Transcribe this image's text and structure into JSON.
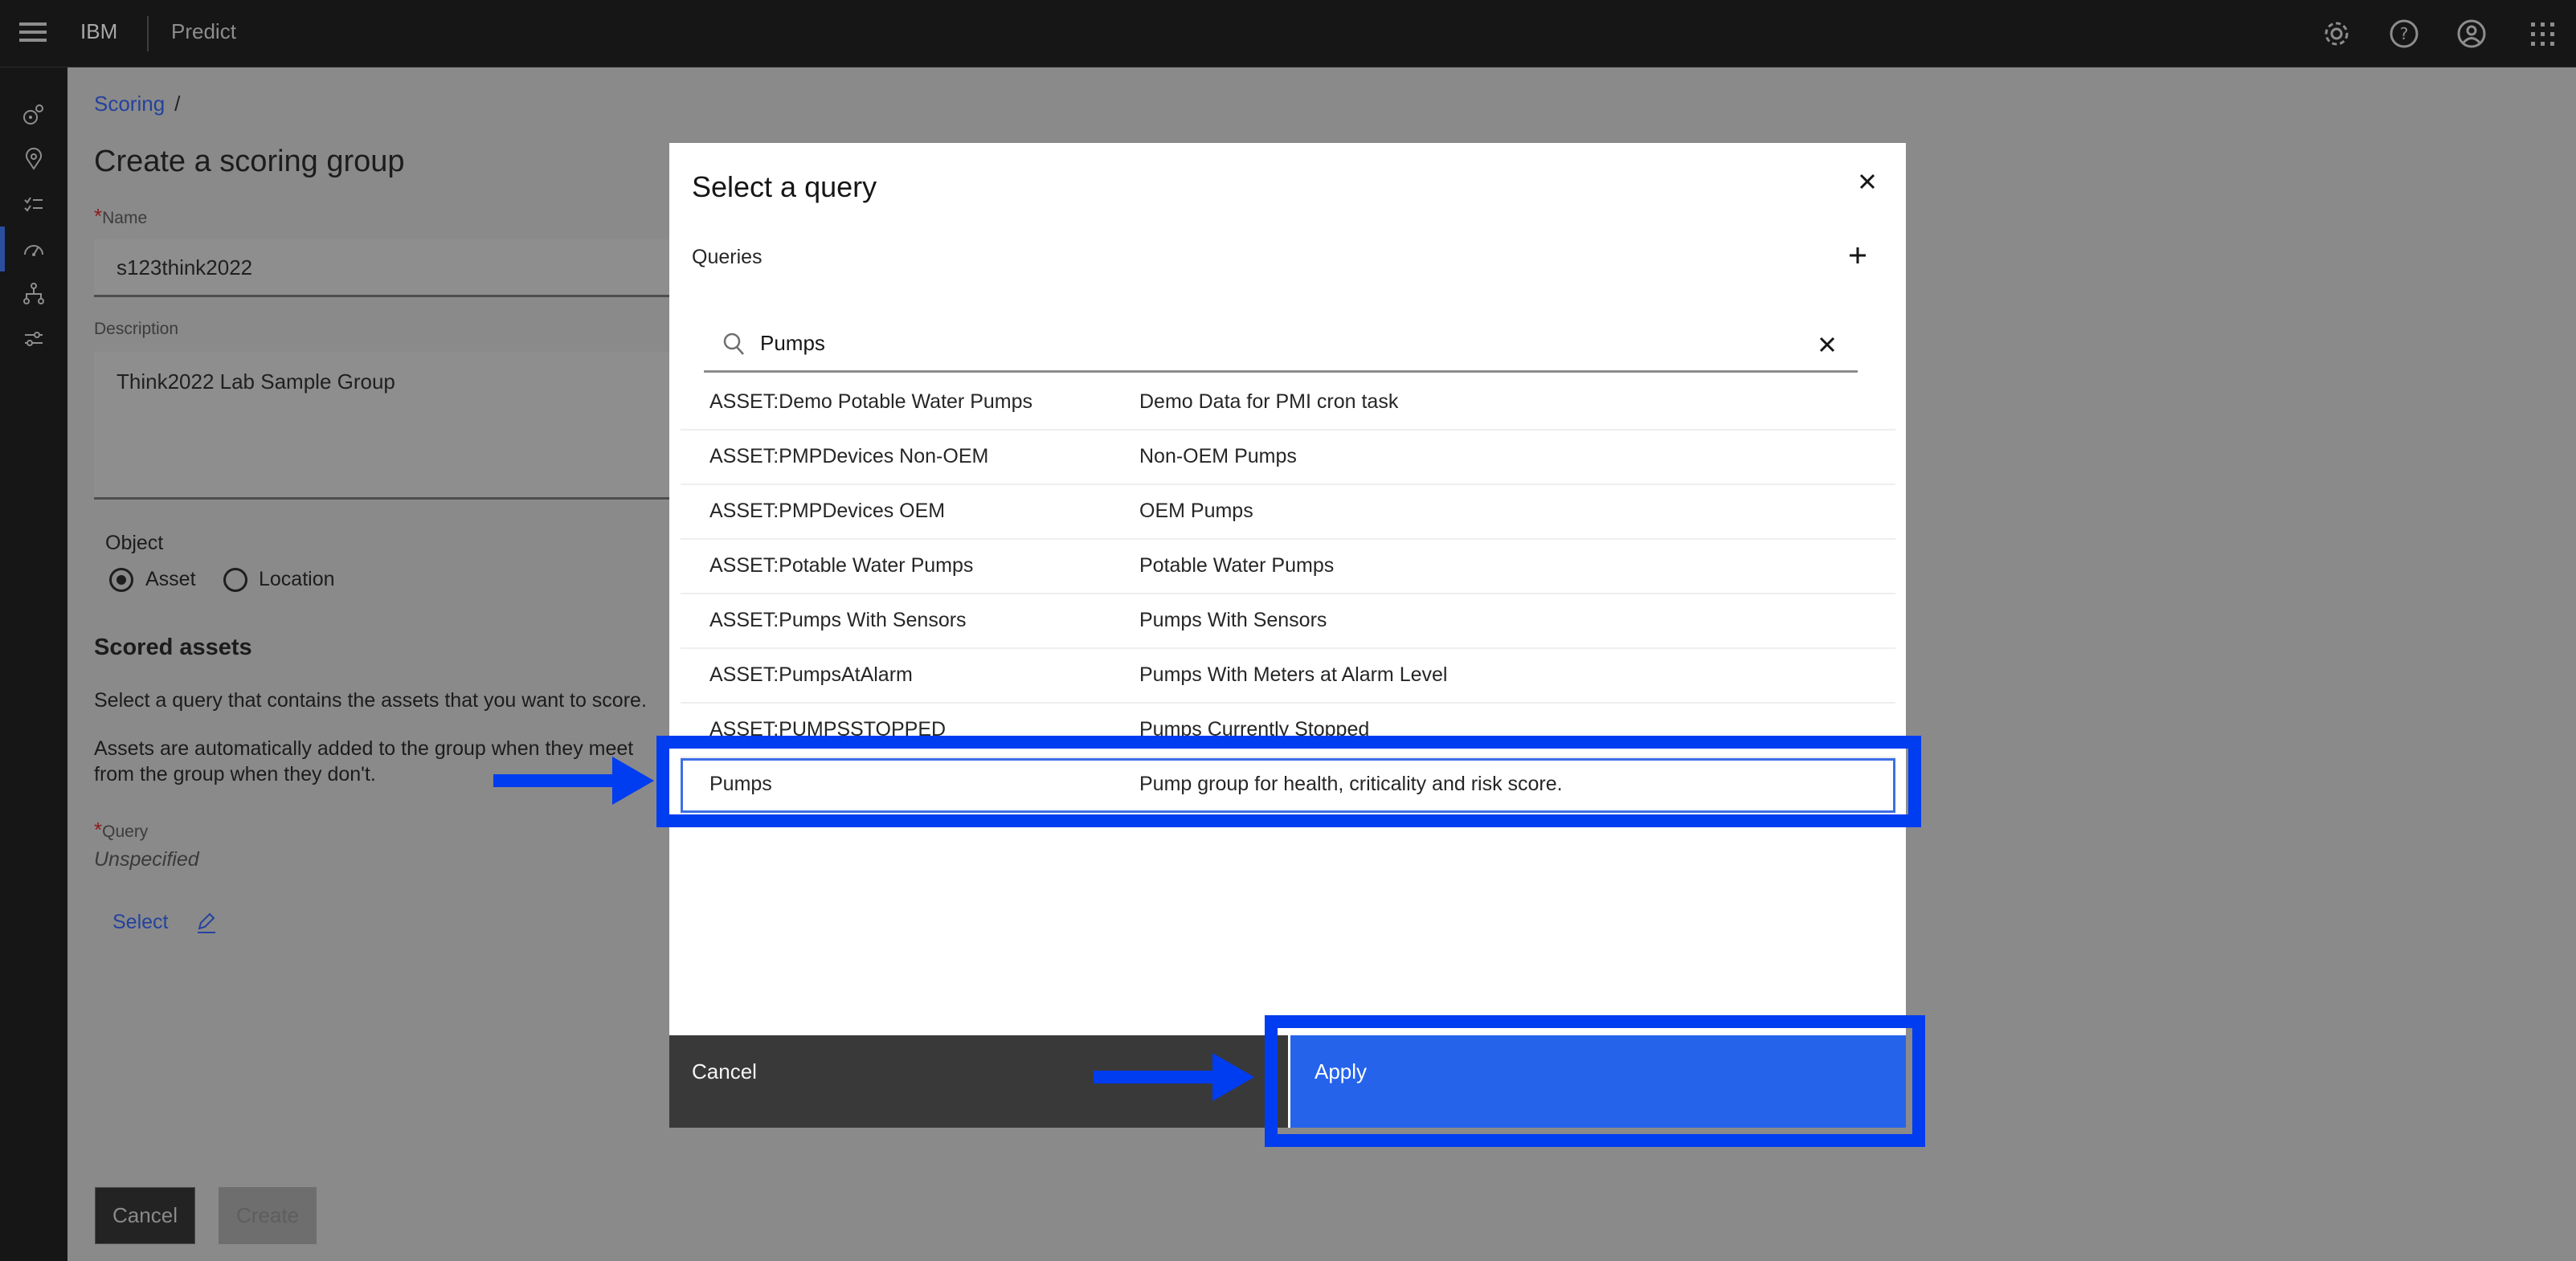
{
  "header": {
    "brand": "IBM",
    "product": "Predict",
    "icons": [
      "menu-icon",
      "settings-icon",
      "help-icon",
      "user-icon",
      "app-switcher-icon"
    ]
  },
  "sidebar": {
    "items": [
      {
        "icon": "asset-icon"
      },
      {
        "icon": "location-icon"
      },
      {
        "icon": "checklist-icon"
      },
      {
        "icon": "scoring-gauge-icon",
        "active": true
      },
      {
        "icon": "hierarchy-icon"
      },
      {
        "icon": "settings-sliders-icon"
      }
    ]
  },
  "page": {
    "breadcrumb": {
      "link": "Scoring",
      "separator": "/"
    },
    "title": "Create a scoring group",
    "name": {
      "required_mark": "*",
      "label": "Name",
      "value": "s123think2022"
    },
    "description": {
      "label": "Description",
      "value": "Think2022 Lab Sample Group"
    },
    "object": {
      "label": "Object",
      "options": [
        {
          "label": "Asset",
          "selected": true
        },
        {
          "label": "Location",
          "selected": false
        }
      ]
    },
    "scored_assets": {
      "heading": "Scored assets",
      "help1": "Select a query that contains the assets that you want to score.",
      "help2_line1": "Assets are automatically added to the group when they meet",
      "help2_line2": "from the group when they don't.",
      "query_required_mark": "*",
      "query_label": "Query",
      "query_value": "Unspecified",
      "select_link": "Select"
    },
    "buttons": {
      "cancel": "Cancel",
      "create": "Create"
    }
  },
  "modal": {
    "title": "Select a query",
    "queries_label": "Queries",
    "search_value": "Pumps",
    "rows": [
      {
        "name": "ASSET:Demo Potable Water Pumps",
        "description": "Demo Data for PMI cron task"
      },
      {
        "name": "ASSET:PMPDevices Non-OEM",
        "description": "Non-OEM Pumps"
      },
      {
        "name": "ASSET:PMPDevices OEM",
        "description": "OEM Pumps"
      },
      {
        "name": "ASSET:Potable Water Pumps",
        "description": "Potable Water Pumps"
      },
      {
        "name": "ASSET:Pumps With Sensors",
        "description": "Pumps With Sensors"
      },
      {
        "name": "ASSET:PumpsAtAlarm",
        "description": "Pumps With Meters at Alarm Level"
      },
      {
        "name": "ASSET:PUMPSSTOPPED",
        "description": "Pumps Currently Stopped"
      },
      {
        "name": "Pumps",
        "description": "Pump group for health, criticality and risk score.",
        "selected": true
      }
    ],
    "cancel_label": "Cancel",
    "apply_label": "Apply"
  },
  "annotations": {
    "color": "#003cf0",
    "targets": [
      "selected-query-row",
      "apply-button"
    ]
  }
}
